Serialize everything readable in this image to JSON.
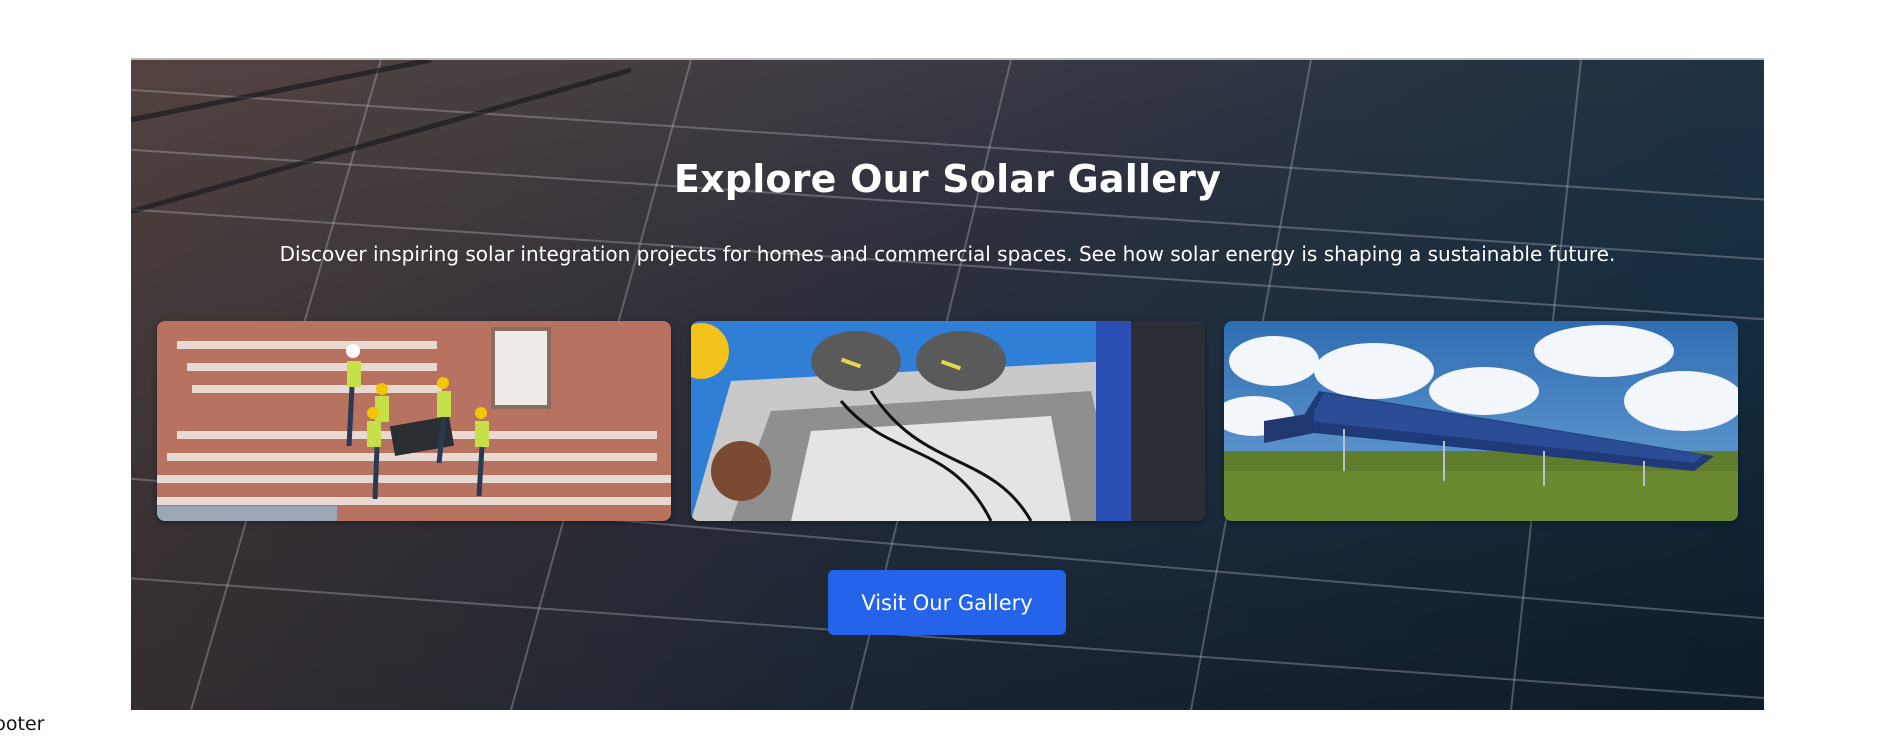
{
  "hero": {
    "title": "Explore Our Solar Gallery",
    "subtitle": "Discover inspiring solar integration projects for homes and commercial spaces. See how solar energy is shaping a sustainable future.",
    "cta_label": "Visit Our Gallery",
    "cta_color": "#2563eb"
  },
  "gallery": {
    "images": [
      {
        "depicts": "workers installing solar panel on tiled roof"
      },
      {
        "depicts": "gloved hands wiring solar connectors"
      },
      {
        "depicts": "ground-mounted solar panel array under cloudy sky"
      }
    ]
  },
  "footer": {
    "text": "Footer"
  }
}
